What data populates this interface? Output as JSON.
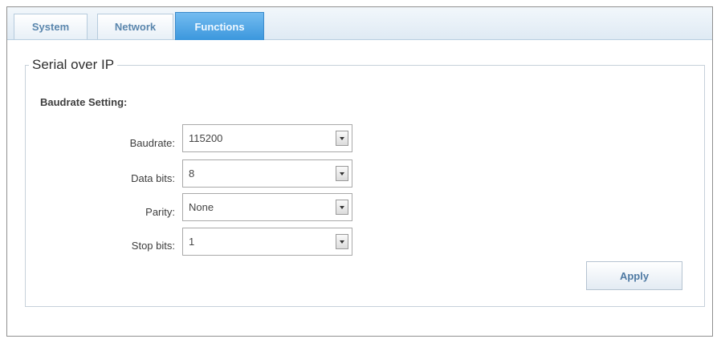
{
  "tabs": [
    {
      "label": "System",
      "active": false
    },
    {
      "label": "Network",
      "active": false
    },
    {
      "label": "Functions",
      "active": true
    }
  ],
  "panel": {
    "legend": "Serial over IP",
    "section_title": "Baudrate Setting:",
    "fields": [
      {
        "label": "Baudrate:",
        "value": "115200"
      },
      {
        "label": "Data bits:",
        "value": "8"
      },
      {
        "label": "Parity:",
        "value": "None"
      },
      {
        "label": "Stop bits:",
        "value": "1"
      }
    ],
    "apply_label": "Apply"
  },
  "colors": {
    "active_tab": "#3b97dd",
    "tab_text": "#5a86ad",
    "border": "#c7d1da"
  }
}
